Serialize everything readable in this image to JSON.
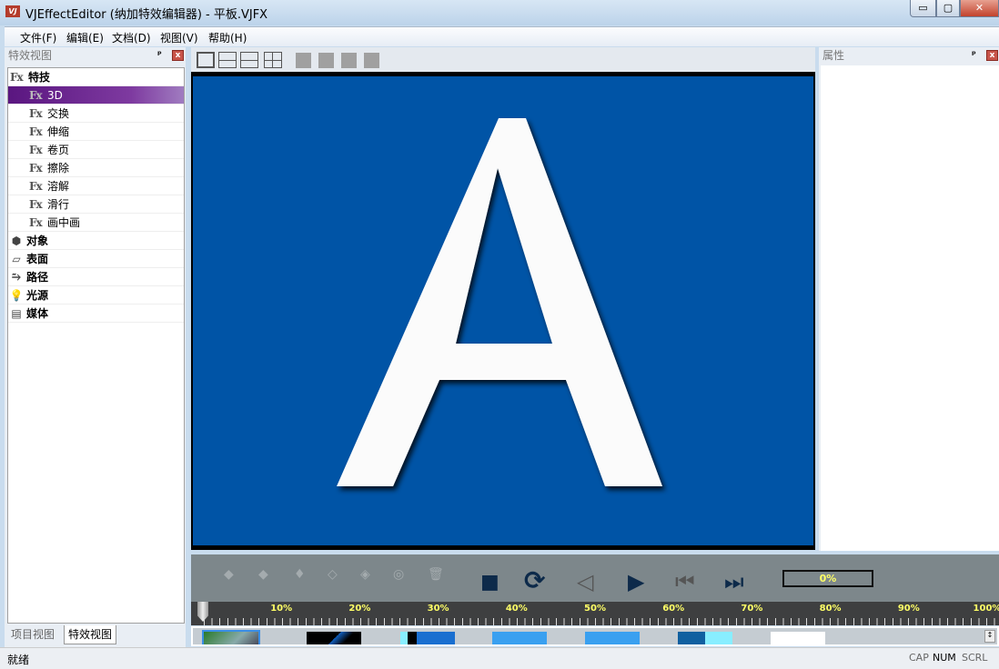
{
  "window": {
    "title": "VJEffectEditor (纳加特效编辑器) - 平板.VJFX",
    "icon_text": "VJFX",
    "min": "▭",
    "max": "▢",
    "close": "✕"
  },
  "menu": [
    "文件(F)",
    "编辑(E)",
    "文档(D)",
    "视图(V)",
    "帮助(H)"
  ],
  "left_panel": {
    "title": "特效视图",
    "pin": "ᵖ",
    "close": "x",
    "tree": [
      {
        "label": "特技",
        "icon": "fx-icon",
        "level": 0
      },
      {
        "label": "3D",
        "icon": "fx-icon",
        "level": 1,
        "selected": true
      },
      {
        "label": "交换",
        "icon": "fx-icon",
        "level": 1
      },
      {
        "label": "伸缩",
        "icon": "fx-icon",
        "level": 1
      },
      {
        "label": "卷页",
        "icon": "fx-icon",
        "level": 1
      },
      {
        "label": "擦除",
        "icon": "fx-icon",
        "level": 1
      },
      {
        "label": "溶解",
        "icon": "fx-icon",
        "level": 1
      },
      {
        "label": "滑行",
        "icon": "fx-icon",
        "level": 1
      },
      {
        "label": "画中画",
        "icon": "fx-icon",
        "level": 1
      },
      {
        "label": "对象",
        "icon": "object-icon",
        "level": 0
      },
      {
        "label": "表面",
        "icon": "surface-icon",
        "level": 0
      },
      {
        "label": "路径",
        "icon": "path-icon",
        "level": 0
      },
      {
        "label": "光源",
        "icon": "light-bulb-icon",
        "level": 0
      },
      {
        "label": "媒体",
        "icon": "film-icon",
        "level": 0
      }
    ],
    "tabs": [
      "项目视图",
      "特效视图"
    ],
    "active_tab": "特效视图"
  },
  "preview": {
    "letter": "A",
    "background": "#0054a6"
  },
  "right_panel": {
    "title": "属性"
  },
  "transport": {
    "progress": "0%"
  },
  "ruler": {
    "labels": [
      "10%",
      "20%",
      "30%",
      "40%",
      "50%",
      "60%",
      "70%",
      "80%",
      "90%",
      "100%"
    ],
    "position_percent": 0
  },
  "status": {
    "text": "就绪",
    "indicators": [
      "CAP",
      "NUM",
      "SCRL"
    ]
  }
}
